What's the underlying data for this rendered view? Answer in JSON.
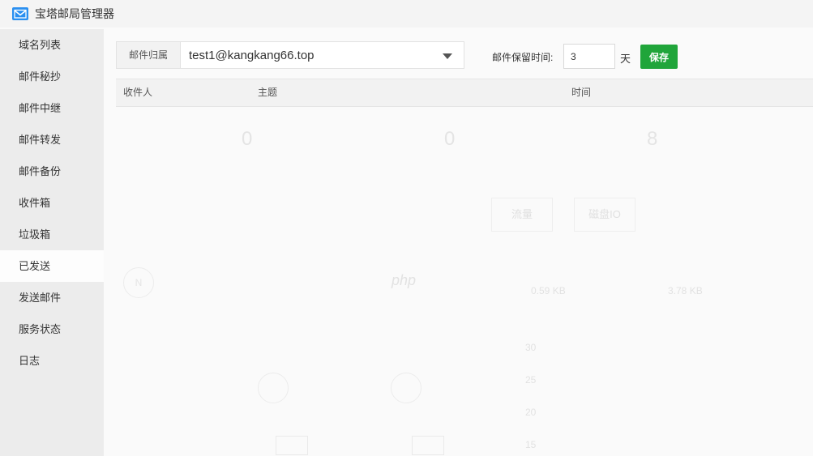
{
  "app": {
    "title": "宝塔邮局管理器",
    "icon": "mail-icon"
  },
  "sidebar": {
    "items": [
      {
        "label": "域名列表",
        "active": false
      },
      {
        "label": "邮件秘抄",
        "active": false
      },
      {
        "label": "邮件中继",
        "active": false
      },
      {
        "label": "邮件转发",
        "active": false
      },
      {
        "label": "邮件备份",
        "active": false
      },
      {
        "label": "收件箱",
        "active": false
      },
      {
        "label": "垃圾箱",
        "active": false
      },
      {
        "label": "已发送",
        "active": true
      },
      {
        "label": "发送邮件",
        "active": false
      },
      {
        "label": "服务状态",
        "active": false
      },
      {
        "label": "日志",
        "active": false
      }
    ]
  },
  "toolbar": {
    "owner_label": "邮件归属",
    "owner_value": "test1@kangkang66.top",
    "retain_label": "邮件保留时间:",
    "retain_value": "3",
    "retain_unit": "天",
    "save_label": "保存"
  },
  "table": {
    "columns": [
      "收件人",
      "主题",
      "时间"
    ],
    "rows": []
  },
  "background": {
    "stats": [
      "0",
      "0",
      "8"
    ],
    "tabs": [
      "流量",
      "磁盘IO"
    ],
    "traffic": [
      "0.59 KB",
      "3.78 KB"
    ],
    "php_label": "php",
    "axis_ticks": [
      "30",
      "25",
      "20",
      "15"
    ],
    "colors": {
      "accent": "#20a53a",
      "icon_blue": "#2a8ff0"
    }
  }
}
